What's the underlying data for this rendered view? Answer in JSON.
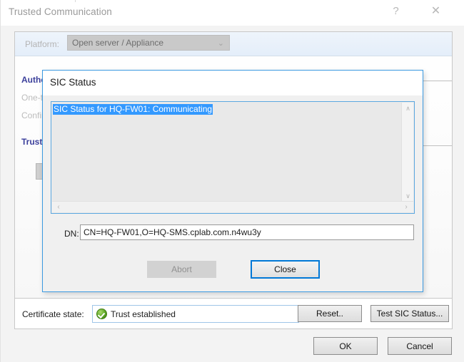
{
  "window": {
    "title": "Trusted Communication",
    "help_icon": "?",
    "close_icon": "✕"
  },
  "platform": {
    "label": "Platform:",
    "selected": "Open server / Appliance",
    "chevron": "⌄"
  },
  "background_form": {
    "labels": [
      {
        "text": "Authe",
        "kind": "head"
      },
      {
        "text": "One-t",
        "kind": "dim"
      },
      {
        "text": "Confir",
        "kind": "dim"
      },
      {
        "text": "Truste",
        "kind": "head"
      }
    ]
  },
  "certificate": {
    "label": "Certificate state:",
    "value": "Trust established",
    "status_color": "#5ba524"
  },
  "buttons": {
    "reset": "Reset..",
    "test_sic": "Test SIC Status...",
    "ok": "OK",
    "cancel": "Cancel"
  },
  "modal": {
    "title": "SIC Status",
    "log_line": "SIC Status for HQ-FW01: Communicating",
    "selection_color": "#3399ff",
    "dn_label": "DN:",
    "dn_value": "CN=HQ-FW01,O=HQ-SMS.cplab.com.n4wu3y",
    "abort_button": "Abort",
    "close_button": "Close",
    "scroll": {
      "up": "∧",
      "down": "∨",
      "left": "‹",
      "right": "›"
    }
  }
}
